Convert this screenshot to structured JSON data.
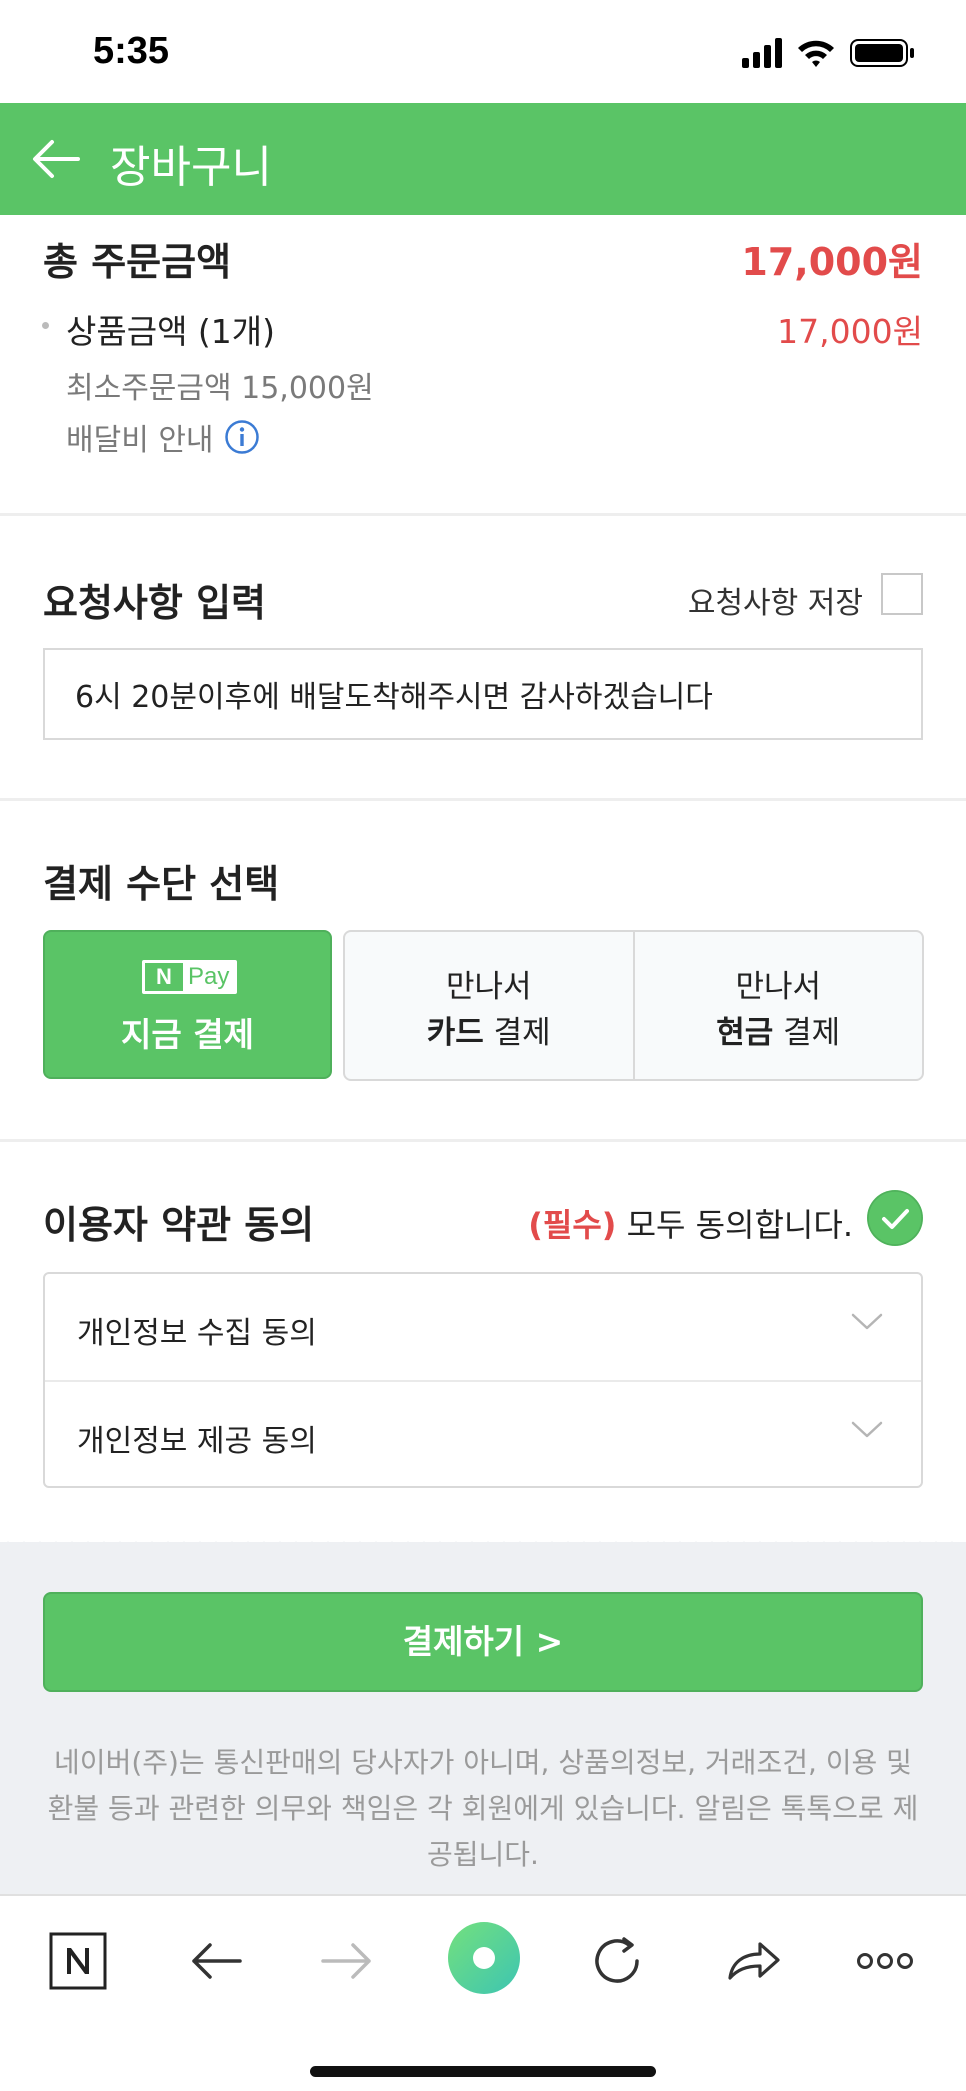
{
  "status_bar": {
    "time": "5:35"
  },
  "header": {
    "title": "장바구니"
  },
  "summary": {
    "total_label": "총 주문금액",
    "total_value": "17,000원",
    "product_label": "상품금액 (1개)",
    "product_value": "17,000원",
    "min_order": "최소주문금액 15,000원",
    "delivery_info": "배달비 안내"
  },
  "request": {
    "title": "요청사항 입력",
    "save_label": "요청사항 저장",
    "input_value": "6시 20분이후에 배달도착해주시면 감사하겠습니다"
  },
  "payment": {
    "title": "결제 수단 선택",
    "npay_n": "N",
    "npay_text": "Pay",
    "pay_now_label": "지금 결제",
    "options": [
      {
        "line1": "만나서",
        "bold": "카드",
        "rest": " 결제"
      },
      {
        "line1": "만나서",
        "bold": "현금",
        "rest": " 결제"
      }
    ]
  },
  "terms": {
    "title": "이용자 약관 동의",
    "required": "(필수)",
    "agree_all": " 모두 동의합니다.",
    "items": [
      "개인정보 수집 동의",
      "개인정보 제공 동의"
    ]
  },
  "checkout": {
    "button_label": "결제하기 >",
    "disclaimer": "네이버(주)는 통신판매의 당사자가 아니며, 상품의정보, 거래조건, 이용 및 환불 등과 관련한 의무와 책임은 각 회원에게 있습니다. 알림은 톡톡으로 제공됩니다."
  },
  "browser_bar": {
    "icons": [
      "naver-home-icon",
      "back-arrow-icon",
      "forward-arrow-icon",
      "green-dot-icon",
      "refresh-icon",
      "share-icon",
      "more-icon"
    ]
  },
  "colors": {
    "brand_green": "#5ac466",
    "price_red": "#e24b4b"
  }
}
